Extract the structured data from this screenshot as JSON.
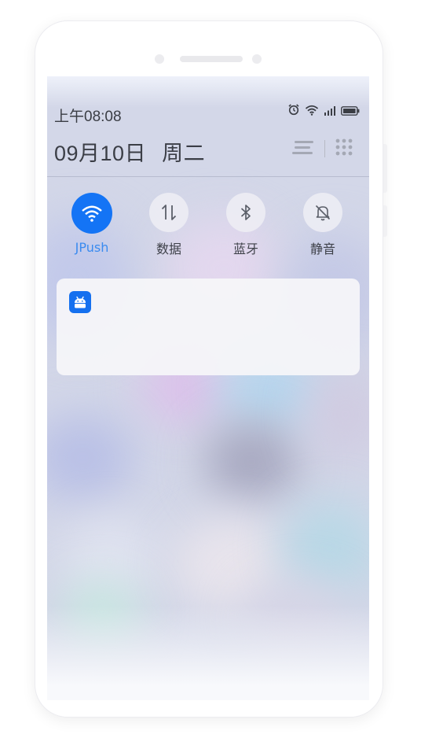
{
  "status_bar": {
    "time": "上午08:08",
    "icons": [
      "alarm-icon",
      "wifi-icon",
      "signal-icon",
      "battery-icon"
    ]
  },
  "header": {
    "date": "09月10日",
    "weekday": "周二",
    "icons": [
      "notification-list-icon",
      "grid-apps-icon"
    ]
  },
  "quick_toggles": [
    {
      "label": "JPush",
      "icon": "wifi-icon",
      "active": true
    },
    {
      "label": "数据",
      "icon": "data-transfer-icon",
      "active": false
    },
    {
      "label": "蓝牙",
      "icon": "bluetooth-icon",
      "active": false
    },
    {
      "label": "静音",
      "icon": "bell-mute-icon",
      "active": false
    }
  ],
  "notification": {
    "app_icon": "android-icon"
  },
  "colors": {
    "accent": "#1474f5",
    "accent_label": "#3a8bf0",
    "text": "#3a3d44"
  }
}
